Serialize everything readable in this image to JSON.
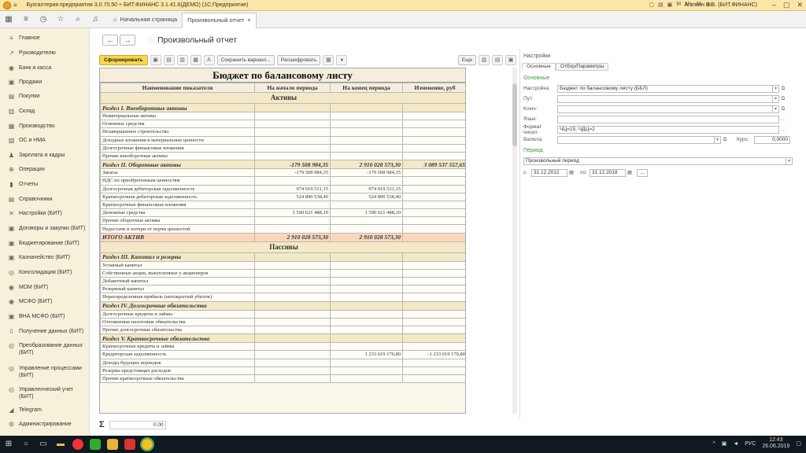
{
  "window": {
    "title": "Бухгалтерия предприятия 3.0.70.50 + БИТ.ФИНАНС 3.1.41.6(ДЕМО)  (1С:Предприятие)",
    "user": "Агапкин В.В. (БИТ.ФИНАНС)",
    "toolbar_icons": [
      "M",
      "M+",
      "M-"
    ]
  },
  "tabs": [
    {
      "label": "Начальная страница"
    },
    {
      "label": "Произвольный отчет",
      "close": "×"
    }
  ],
  "sidebar": {
    "items": [
      {
        "icon": "≡",
        "label": "Главное"
      },
      {
        "icon": "↗",
        "label": "Руководителю"
      },
      {
        "icon": "◉",
        "label": "Банк и касса"
      },
      {
        "icon": "▣",
        "label": "Продажи"
      },
      {
        "icon": "▤",
        "label": "Покупки"
      },
      {
        "icon": "▥",
        "label": "Склад"
      },
      {
        "icon": "▦",
        "label": "Производство"
      },
      {
        "icon": "▨",
        "label": "ОС и НМА"
      },
      {
        "icon": "♟",
        "label": "Зарплата и кадры"
      },
      {
        "icon": "⊕",
        "label": "Операции"
      },
      {
        "icon": "▮",
        "label": "Отчеты"
      },
      {
        "icon": "▤",
        "label": "Справочники"
      },
      {
        "icon": "✕",
        "label": "Настройки (БИТ)"
      },
      {
        "icon": "▣",
        "label": "Договоры и закупки (БИТ)"
      },
      {
        "icon": "▣",
        "label": "Бюджетирование (БИТ)"
      },
      {
        "icon": "▣",
        "label": "Казначейство (БИТ)"
      },
      {
        "icon": "◎",
        "label": "Консолидация (БИТ)"
      },
      {
        "icon": "◉",
        "label": "MDM (БИТ)"
      },
      {
        "icon": "◉",
        "label": "МСФО (БИТ)"
      },
      {
        "icon": "▣",
        "label": "ВНА МСФО (БИТ)"
      },
      {
        "icon": "⇩",
        "label": "Получение данных (БИТ)"
      },
      {
        "icon": "◎",
        "label": "Преобразование данных (БИТ)"
      },
      {
        "icon": "◎",
        "label": "Управление процессами (БИТ)"
      },
      {
        "icon": "◎",
        "label": "Управленческий учет (БИТ)"
      },
      {
        "icon": "◢",
        "label": "Telegram"
      },
      {
        "icon": "⚙",
        "label": "Администрирование"
      }
    ]
  },
  "page": {
    "title": "Произвольный отчет",
    "back": "←",
    "forward": "→",
    "star": "☆"
  },
  "toolbar": {
    "generate": "Сформировать",
    "save_variant": "Сохранить вариант...",
    "decode": "Расшифровать",
    "more": "Еще"
  },
  "report": {
    "title": "Бюджет по балансовому листу",
    "columns": [
      "Наименование показателя",
      "На начало периода",
      "На конец периода",
      "Изменение, руб"
    ],
    "rows": [
      {
        "type": "group",
        "cells": [
          "Активы"
        ]
      },
      {
        "type": "section",
        "cells": [
          "Раздел I. Внеоборотные активы",
          "",
          "",
          ""
        ]
      },
      {
        "type": "item",
        "cells": [
          "Нематериальные активы",
          "",
          "",
          ""
        ]
      },
      {
        "type": "item",
        "cells": [
          "Основные средства",
          "",
          "",
          ""
        ]
      },
      {
        "type": "item",
        "cells": [
          "Незавершенное строительство",
          "",
          "",
          ""
        ]
      },
      {
        "type": "item",
        "cells": [
          "Доходные вложения в материальные ценности",
          "",
          "",
          ""
        ]
      },
      {
        "type": "item",
        "cells": [
          "Долгосрочные финансовые вложения",
          "",
          "",
          ""
        ]
      },
      {
        "type": "item",
        "cells": [
          "Прочие внеоборотные активы",
          "",
          "",
          ""
        ]
      },
      {
        "type": "section",
        "cells": [
          "Раздел II. Оборотные активы",
          "-179 508 984,35",
          "2 910 028 573,30",
          "3 089 537 557,65"
        ]
      },
      {
        "type": "item",
        "cells": [
          "Запасы",
          "-179 508 984,35",
          "-179 508 984,35",
          ""
        ]
      },
      {
        "type": "item",
        "cells": [
          "НДС по приобретенным ценностям",
          "",
          "",
          ""
        ]
      },
      {
        "type": "item",
        "cells": [
          "Долгосрочная дебиторская задолженность",
          "974 019 531,15",
          "974 019 531,15",
          ""
        ]
      },
      {
        "type": "item",
        "cells": [
          "Краткосрочная дебиторская задолженность",
          "524 896 538,40",
          "524 896 538,40",
          ""
        ]
      },
      {
        "type": "item",
        "cells": [
          "Краткосрочные финансовые вложения",
          "",
          "",
          ""
        ]
      },
      {
        "type": "item",
        "cells": [
          "Денежные средства",
          "1 590 621 488,10",
          "1 590 621 488,10",
          ""
        ]
      },
      {
        "type": "item",
        "cells": [
          "Прочие оборотные активы",
          "",
          "",
          ""
        ]
      },
      {
        "type": "item",
        "cells": [
          "Недостачи и потери от порчи ценностей",
          "",
          "",
          ""
        ]
      },
      {
        "type": "total",
        "cells": [
          "ИТОГО АКТИВ",
          "2 910 028 573,30",
          "2 910 028 573,30",
          ""
        ]
      },
      {
        "type": "group",
        "cells": [
          "Пассивы"
        ]
      },
      {
        "type": "section",
        "cells": [
          "Раздел III. Капитал и резервы",
          "",
          "",
          ""
        ]
      },
      {
        "type": "item",
        "cells": [
          "Уставный капитал",
          "",
          "",
          ""
        ]
      },
      {
        "type": "item",
        "cells": [
          "Собственные акции, выкупленные у акционеров",
          "",
          "",
          ""
        ]
      },
      {
        "type": "item",
        "cells": [
          "Добавочный капитал",
          "",
          "",
          ""
        ]
      },
      {
        "type": "item",
        "cells": [
          "Резервный капитал",
          "",
          "",
          ""
        ]
      },
      {
        "type": "item",
        "cells": [
          "Нераспределенная прибыль (непокрытый убыток)",
          "",
          "",
          ""
        ]
      },
      {
        "type": "section",
        "cells": [
          "Раздел IV.  Долгосрочные обязательства",
          "",
          "",
          ""
        ]
      },
      {
        "type": "item",
        "cells": [
          "Долгосрочные кредиты и займы",
          "",
          "",
          ""
        ]
      },
      {
        "type": "item",
        "cells": [
          "Отложенные налоговые обязательства",
          "",
          "",
          ""
        ]
      },
      {
        "type": "item",
        "cells": [
          "Прочие долгосрочные обязательства",
          "",
          "",
          ""
        ]
      },
      {
        "type": "section",
        "cells": [
          "Раздел V. Краткосрочные обязательства",
          "",
          "",
          ""
        ]
      },
      {
        "type": "item",
        "cells": [
          "Краткосрочные кредиты и займы",
          "",
          "",
          ""
        ]
      },
      {
        "type": "item",
        "cells": [
          "Кредиторская задолженность",
          "",
          "1 233 619 170,80",
          "-1 233 619 170,80"
        ]
      },
      {
        "type": "item",
        "cells": [
          "Доходы будущих периодов",
          "",
          "",
          ""
        ]
      },
      {
        "type": "item",
        "cells": [
          "Резервы предстоящих расходов",
          "",
          "",
          ""
        ]
      },
      {
        "type": "item",
        "cells": [
          "Прочие краткосрочные обязательства",
          "",
          "",
          ""
        ]
      }
    ]
  },
  "sum": {
    "symbol": "Σ",
    "value": "0.00"
  },
  "settings": {
    "title": "Настройки",
    "tabs": [
      "Основные",
      "Отбор/Параметры"
    ],
    "group_main": "Основные",
    "fields": {
      "settings_label": "Настройка:",
      "settings_value": "Бюджет по балансовому листу (ББЛ)",
      "path_label": "Пут:",
      "key_label": "Ключ:",
      "lang_label": "Язык:",
      "format_label": "Формат чисел:",
      "format_value": "ЧЦ=15; ЧДЦ=2",
      "currency_label": "Валюта:",
      "rate_label": "Курс:",
      "rate_value": "0,0000"
    },
    "group_period": "Период",
    "period_value": "Произвольный период",
    "from_label": "с:",
    "from_value": "31.12.2012",
    "to_label": "по:",
    "to_value": "31.12.2018",
    "dots": "..."
  },
  "taskbar": {
    "lang": "РУС",
    "time": "12:43",
    "date": "26.06.2019"
  }
}
